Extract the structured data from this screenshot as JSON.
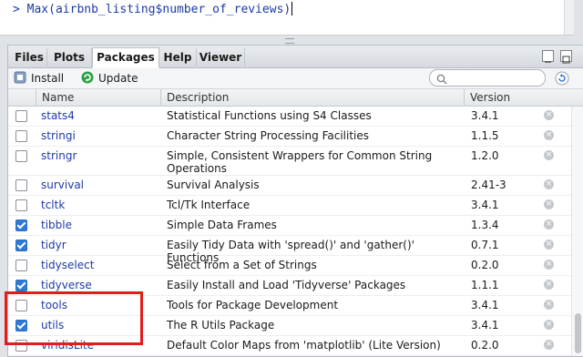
{
  "console": {
    "prompt": ">",
    "command": "Max(airbnb_listing$number_of_reviews)"
  },
  "tabs": [
    {
      "label": "Files",
      "active": false
    },
    {
      "label": "Plots",
      "active": false
    },
    {
      "label": "Packages",
      "active": true
    },
    {
      "label": "Help",
      "active": false
    },
    {
      "label": "Viewer",
      "active": false
    }
  ],
  "toolbar": {
    "install_label": "Install",
    "update_label": "Update",
    "search_placeholder": ""
  },
  "table": {
    "columns": [
      "Name",
      "Description",
      "Version"
    ],
    "rows": [
      {
        "checked": false,
        "name": "stats4",
        "description": "Statistical Functions using S4 Classes",
        "version": "3.4.1"
      },
      {
        "checked": false,
        "name": "stringi",
        "description": "Character String Processing Facilities",
        "version": "1.1.5"
      },
      {
        "checked": false,
        "name": "stringr",
        "description": "Simple, Consistent Wrappers for Common String Operations",
        "version": "1.2.0"
      },
      {
        "checked": false,
        "name": "survival",
        "description": "Survival Analysis",
        "version": "2.41-3"
      },
      {
        "checked": false,
        "name": "tcltk",
        "description": "Tcl/Tk Interface",
        "version": "3.4.1"
      },
      {
        "checked": true,
        "name": "tibble",
        "description": "Simple Data Frames",
        "version": "1.3.4"
      },
      {
        "checked": true,
        "name": "tidyr",
        "description": "Easily Tidy Data with 'spread()' and 'gather()' Functions",
        "version": "0.7.1"
      },
      {
        "checked": false,
        "name": "tidyselect",
        "description": "Select from a Set of Strings",
        "version": "0.2.0"
      },
      {
        "checked": true,
        "name": "tidyverse",
        "description": "Easily Install and Load 'Tidyverse' Packages",
        "version": "1.1.1"
      },
      {
        "checked": false,
        "name": "tools",
        "description": "Tools for Package Development",
        "version": "3.4.1"
      },
      {
        "checked": true,
        "name": "utils",
        "description": "The R Utils Package",
        "version": "3.4.1"
      },
      {
        "checked": false,
        "name": "viridisLite",
        "description": "Default Color Maps from 'matplotlib' (Lite Version)",
        "version": "0.2.0"
      }
    ]
  },
  "colors": {
    "accent": "#2f7ad8",
    "link": "#1f3aa8",
    "highlight": "#e31b1b"
  },
  "icons": {
    "install": "install-icon",
    "update": "update-icon",
    "search": "search-icon",
    "refresh": "refresh-icon",
    "delete": "delete-icon"
  }
}
